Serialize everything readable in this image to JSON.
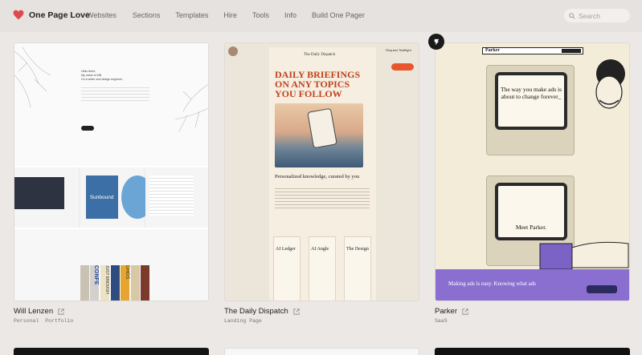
{
  "header": {
    "brand": "One Page Love",
    "nav": [
      "Websites",
      "Sections",
      "Templates",
      "Hire",
      "Tools",
      "Info",
      "Build One Pager"
    ],
    "search_placeholder": "Search"
  },
  "cards": [
    {
      "title": "Will Lenzen",
      "tags": [
        "Personal",
        "Portfolio"
      ]
    },
    {
      "title": "The Daily Dispatch",
      "tags": [
        "Landing Page"
      ]
    },
    {
      "title": "Parker",
      "tags": [
        "SaaS"
      ]
    }
  ],
  "previews": {
    "will": {
      "hero_lines": [
        "Hello there,",
        "My name is Will.",
        "I'm a writer and design engineer."
      ],
      "sunbound": "Sunbound",
      "book_spines": [
        "CONFE",
        "JUST ENOUGH",
        "DHOS"
      ]
    },
    "dispatch": {
      "masthead": "The Daily Dispatch",
      "headline": "DAILY BRIEFINGS ON ANY TOPICS YOU FOLLOW",
      "subhead": "Personalized knowledge, curated by you",
      "cta": "Request Testflight",
      "col_titles": [
        "AI Ledger",
        "AI Angle",
        "The Design"
      ]
    },
    "parker": {
      "logo": "Parker",
      "screen_text": "The way you make ads is about to change forever_",
      "screen2_text": "Meet Parker.",
      "purple_text": "Making ads is easy. Knowing what ads"
    }
  },
  "colors": {
    "brand_heart": "#e0484e",
    "dispatch_red": "#c0431c",
    "parker_purple": "#8a6fd1"
  }
}
